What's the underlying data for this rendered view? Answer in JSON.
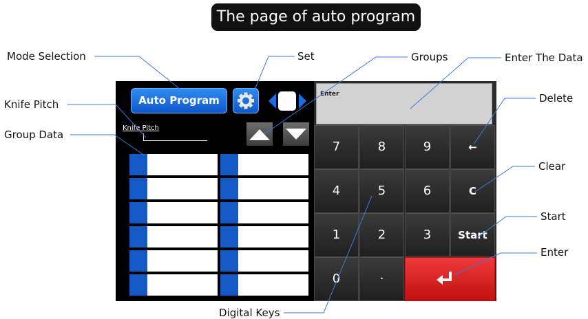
{
  "title": "The page of auto program",
  "panel": {
    "mode_button_label": "Auto Program",
    "knife_pitch_label": "Knife Pitch",
    "display_label": "Enter"
  },
  "keypad": {
    "keys": [
      "7",
      "8",
      "9",
      "←",
      "4",
      "5",
      "6",
      "C",
      "1",
      "2",
      "3",
      "Start",
      "0",
      "·",
      ""
    ]
  },
  "callouts": {
    "mode_selection": "Mode Selection",
    "set": "Set",
    "groups": "Groups",
    "enter_the_data": "Enter The Data",
    "knife_pitch": "Knife Pitch",
    "delete": "Delete",
    "group_data": "Group Data",
    "clear": "Clear",
    "start": "Start",
    "enter": "Enter",
    "digital_keys": "Digital Keys"
  },
  "colors": {
    "accent_blue": "#1a6fe0",
    "enter_red": "#e02020",
    "callout_line": "#3c78d8"
  }
}
